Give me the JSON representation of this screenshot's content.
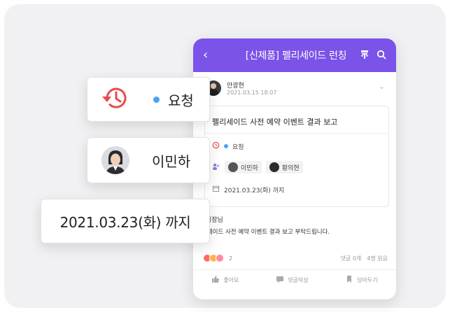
{
  "header": {
    "title": "[신제품] 펠리세이드 런칭"
  },
  "post": {
    "author_name": "안광현",
    "date": "2021.03.15  18:07",
    "title": "펠리세이드 사전 예약 이벤트 결과 보고",
    "status": "요청",
    "assignees": [
      "이민하",
      "황의현"
    ],
    "due": "2021.03.23(화) 까지"
  },
  "comment": {
    "author": "팀장님",
    "body": "리세이드 사전 예약 이벤트 결과 보고 부탁드립니다."
  },
  "stats": {
    "reaction_count": "2",
    "comments": "댓글 0개",
    "views": "4명 읽음"
  },
  "actions": {
    "like": "좋아요",
    "comment": "댓글작성",
    "bookmark": "담아두기"
  },
  "cards": {
    "status": "요청",
    "user": "이민하",
    "date": "2021.03.23(화) 까지"
  },
  "colors": {
    "header": "#7b53e8",
    "status_dot": "#4aa3f0",
    "history_icon": "#e84b4b"
  }
}
